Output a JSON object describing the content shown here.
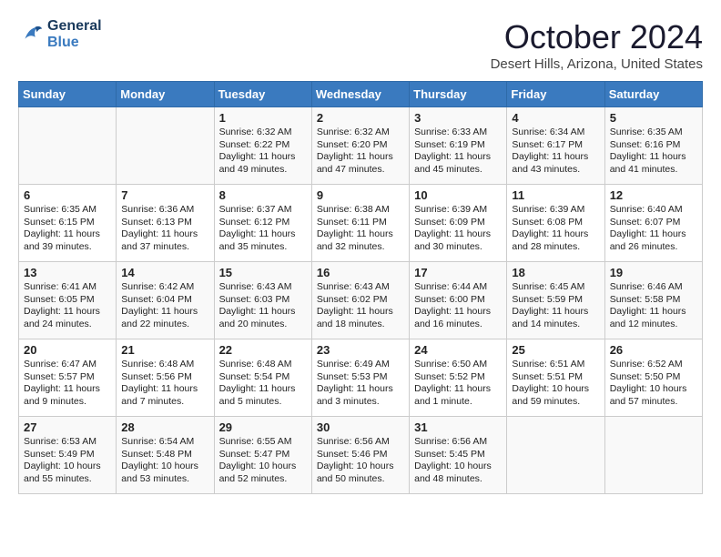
{
  "logo": {
    "line1": "General",
    "line2": "Blue"
  },
  "title": "October 2024",
  "subtitle": "Desert Hills, Arizona, United States",
  "weekdays": [
    "Sunday",
    "Monday",
    "Tuesday",
    "Wednesday",
    "Thursday",
    "Friday",
    "Saturday"
  ],
  "weeks": [
    [
      {
        "day": "",
        "content": ""
      },
      {
        "day": "",
        "content": ""
      },
      {
        "day": "1",
        "content": "Sunrise: 6:32 AM\nSunset: 6:22 PM\nDaylight: 11 hours and 49 minutes."
      },
      {
        "day": "2",
        "content": "Sunrise: 6:32 AM\nSunset: 6:20 PM\nDaylight: 11 hours and 47 minutes."
      },
      {
        "day": "3",
        "content": "Sunrise: 6:33 AM\nSunset: 6:19 PM\nDaylight: 11 hours and 45 minutes."
      },
      {
        "day": "4",
        "content": "Sunrise: 6:34 AM\nSunset: 6:17 PM\nDaylight: 11 hours and 43 minutes."
      },
      {
        "day": "5",
        "content": "Sunrise: 6:35 AM\nSunset: 6:16 PM\nDaylight: 11 hours and 41 minutes."
      }
    ],
    [
      {
        "day": "6",
        "content": "Sunrise: 6:35 AM\nSunset: 6:15 PM\nDaylight: 11 hours and 39 minutes."
      },
      {
        "day": "7",
        "content": "Sunrise: 6:36 AM\nSunset: 6:13 PM\nDaylight: 11 hours and 37 minutes."
      },
      {
        "day": "8",
        "content": "Sunrise: 6:37 AM\nSunset: 6:12 PM\nDaylight: 11 hours and 35 minutes."
      },
      {
        "day": "9",
        "content": "Sunrise: 6:38 AM\nSunset: 6:11 PM\nDaylight: 11 hours and 32 minutes."
      },
      {
        "day": "10",
        "content": "Sunrise: 6:39 AM\nSunset: 6:09 PM\nDaylight: 11 hours and 30 minutes."
      },
      {
        "day": "11",
        "content": "Sunrise: 6:39 AM\nSunset: 6:08 PM\nDaylight: 11 hours and 28 minutes."
      },
      {
        "day": "12",
        "content": "Sunrise: 6:40 AM\nSunset: 6:07 PM\nDaylight: 11 hours and 26 minutes."
      }
    ],
    [
      {
        "day": "13",
        "content": "Sunrise: 6:41 AM\nSunset: 6:05 PM\nDaylight: 11 hours and 24 minutes."
      },
      {
        "day": "14",
        "content": "Sunrise: 6:42 AM\nSunset: 6:04 PM\nDaylight: 11 hours and 22 minutes."
      },
      {
        "day": "15",
        "content": "Sunrise: 6:43 AM\nSunset: 6:03 PM\nDaylight: 11 hours and 20 minutes."
      },
      {
        "day": "16",
        "content": "Sunrise: 6:43 AM\nSunset: 6:02 PM\nDaylight: 11 hours and 18 minutes."
      },
      {
        "day": "17",
        "content": "Sunrise: 6:44 AM\nSunset: 6:00 PM\nDaylight: 11 hours and 16 minutes."
      },
      {
        "day": "18",
        "content": "Sunrise: 6:45 AM\nSunset: 5:59 PM\nDaylight: 11 hours and 14 minutes."
      },
      {
        "day": "19",
        "content": "Sunrise: 6:46 AM\nSunset: 5:58 PM\nDaylight: 11 hours and 12 minutes."
      }
    ],
    [
      {
        "day": "20",
        "content": "Sunrise: 6:47 AM\nSunset: 5:57 PM\nDaylight: 11 hours and 9 minutes."
      },
      {
        "day": "21",
        "content": "Sunrise: 6:48 AM\nSunset: 5:56 PM\nDaylight: 11 hours and 7 minutes."
      },
      {
        "day": "22",
        "content": "Sunrise: 6:48 AM\nSunset: 5:54 PM\nDaylight: 11 hours and 5 minutes."
      },
      {
        "day": "23",
        "content": "Sunrise: 6:49 AM\nSunset: 5:53 PM\nDaylight: 11 hours and 3 minutes."
      },
      {
        "day": "24",
        "content": "Sunrise: 6:50 AM\nSunset: 5:52 PM\nDaylight: 11 hours and 1 minute."
      },
      {
        "day": "25",
        "content": "Sunrise: 6:51 AM\nSunset: 5:51 PM\nDaylight: 10 hours and 59 minutes."
      },
      {
        "day": "26",
        "content": "Sunrise: 6:52 AM\nSunset: 5:50 PM\nDaylight: 10 hours and 57 minutes."
      }
    ],
    [
      {
        "day": "27",
        "content": "Sunrise: 6:53 AM\nSunset: 5:49 PM\nDaylight: 10 hours and 55 minutes."
      },
      {
        "day": "28",
        "content": "Sunrise: 6:54 AM\nSunset: 5:48 PM\nDaylight: 10 hours and 53 minutes."
      },
      {
        "day": "29",
        "content": "Sunrise: 6:55 AM\nSunset: 5:47 PM\nDaylight: 10 hours and 52 minutes."
      },
      {
        "day": "30",
        "content": "Sunrise: 6:56 AM\nSunset: 5:46 PM\nDaylight: 10 hours and 50 minutes."
      },
      {
        "day": "31",
        "content": "Sunrise: 6:56 AM\nSunset: 5:45 PM\nDaylight: 10 hours and 48 minutes."
      },
      {
        "day": "",
        "content": ""
      },
      {
        "day": "",
        "content": ""
      }
    ]
  ]
}
